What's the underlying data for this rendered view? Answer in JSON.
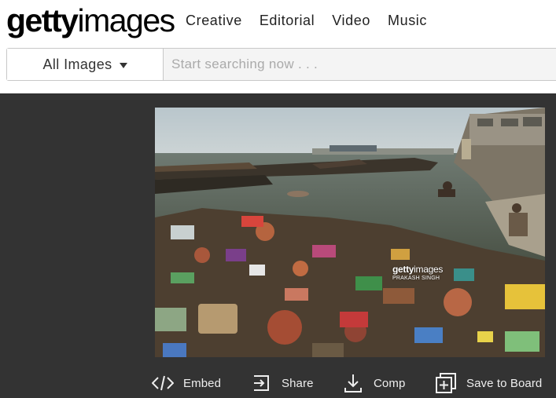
{
  "brand": {
    "bold": "getty",
    "light": "images"
  },
  "nav": [
    {
      "label": "Creative"
    },
    {
      "label": "Editorial"
    },
    {
      "label": "Video"
    },
    {
      "label": "Music"
    }
  ],
  "search": {
    "filter_label": "All Images",
    "placeholder": "Start searching now . . ."
  },
  "photo": {
    "watermark_logo_bold": "getty",
    "watermark_logo_light": "images",
    "watermark_credit": "PRAKASH SINGH"
  },
  "actions": {
    "embed": {
      "label": "Embed",
      "icon": "code-icon"
    },
    "share": {
      "label": "Share",
      "icon": "share-icon"
    },
    "comp": {
      "label": "Comp",
      "icon": "download-icon"
    },
    "board": {
      "label": "Save to Board",
      "icon": "add-board-icon"
    }
  },
  "colors": {
    "background": "#333333",
    "header": "#ffffff",
    "action_text": "#eeeeee"
  }
}
